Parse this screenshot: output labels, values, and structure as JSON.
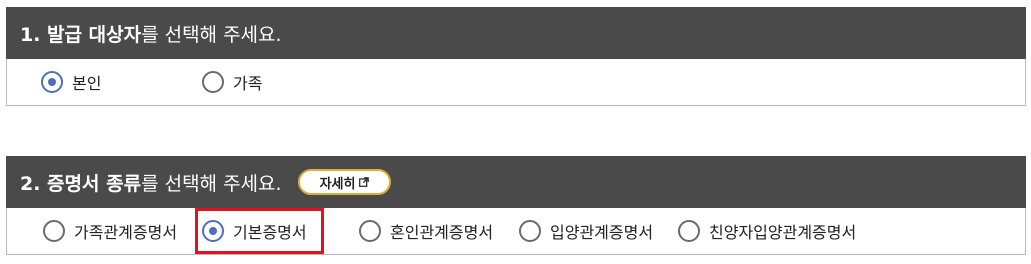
{
  "step1": {
    "title_strong": "1. 발급 대상자",
    "title_rest": "를 선택해 주세요.",
    "options": [
      {
        "label": "본인",
        "checked": true
      },
      {
        "label": "가족",
        "checked": false
      }
    ]
  },
  "step2": {
    "title_strong": "2. 증명서 종류",
    "title_rest": "를 선택해 주세요.",
    "detail_button": "자세히",
    "options": [
      {
        "label": "가족관계증명서",
        "checked": false
      },
      {
        "label": "기본증명서",
        "checked": true
      },
      {
        "label": "혼인관계증명서",
        "checked": false
      },
      {
        "label": "입양관계증명서",
        "checked": false
      },
      {
        "label": "친양자입양관계증명서",
        "checked": false
      }
    ]
  },
  "colors": {
    "header_bg": "#4a4a4a",
    "radio_checked": "#4e6fbf",
    "detail_border": "#d8b236",
    "highlight_box": "#e0141e"
  }
}
